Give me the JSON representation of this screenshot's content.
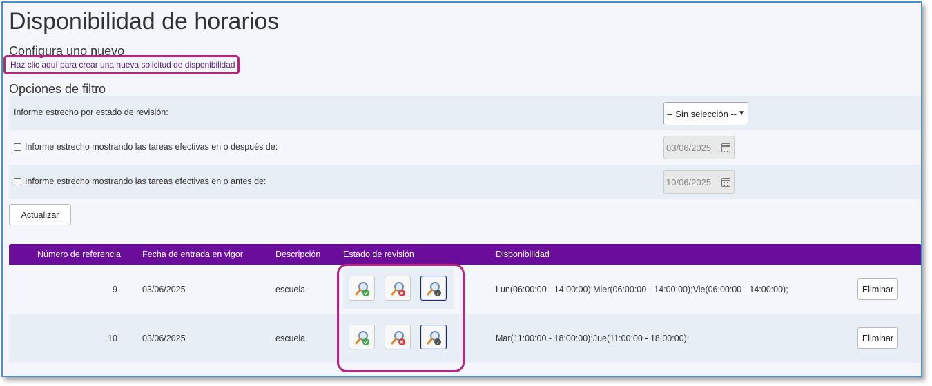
{
  "page": {
    "title": "Disponibilidad de horarios",
    "create_section_title": "Configura uno nuevo",
    "create_link": "Haz clic aquí para crear una nueva solicitud de disponibilidad",
    "filter_section_title": "Opciones de filtro"
  },
  "filters": {
    "status_label": "Informe estrecho por estado de revisión:",
    "status_selected": "-- Sin selección --",
    "after_label": "Informe estrecho mostrando las tareas efectivas en o después de:",
    "after_date": "03/06/2025",
    "before_label": "Informe estrecho mostrando las tareas efectivas en o antes de:",
    "before_date": "10/06/2025",
    "update_button": "Actualizar"
  },
  "table": {
    "headers": [
      "Número de referencia",
      "Fecha de entrada en vigor",
      "Descripción",
      "Estado de revisión",
      "Disponibilidad"
    ],
    "rows": [
      {
        "ref": "9",
        "date": "03/06/2025",
        "description": "escuela",
        "availability": "Lun(06:00:00 - 14:00:00);Mier(06:00:00 - 14:00:00);Vie(06:00:00 - 14:00:00);",
        "delete_label": "Eliminar"
      },
      {
        "ref": "10",
        "date": "03/06/2025",
        "description": "escuela",
        "availability": "Mar(11:00:00 - 18:00:00);Jue(11:00:00 - 18:00:00);",
        "delete_label": "Eliminar"
      }
    ]
  },
  "icons": {
    "approve": "magnifier-check-icon",
    "reject": "magnifier-x-icon",
    "pending": "magnifier-question-icon"
  },
  "colors": {
    "header_bg": "#6a0d9b",
    "highlight_border": "#b5267f",
    "row_shade": "#e8eef6",
    "link": "#5b1f7a"
  }
}
